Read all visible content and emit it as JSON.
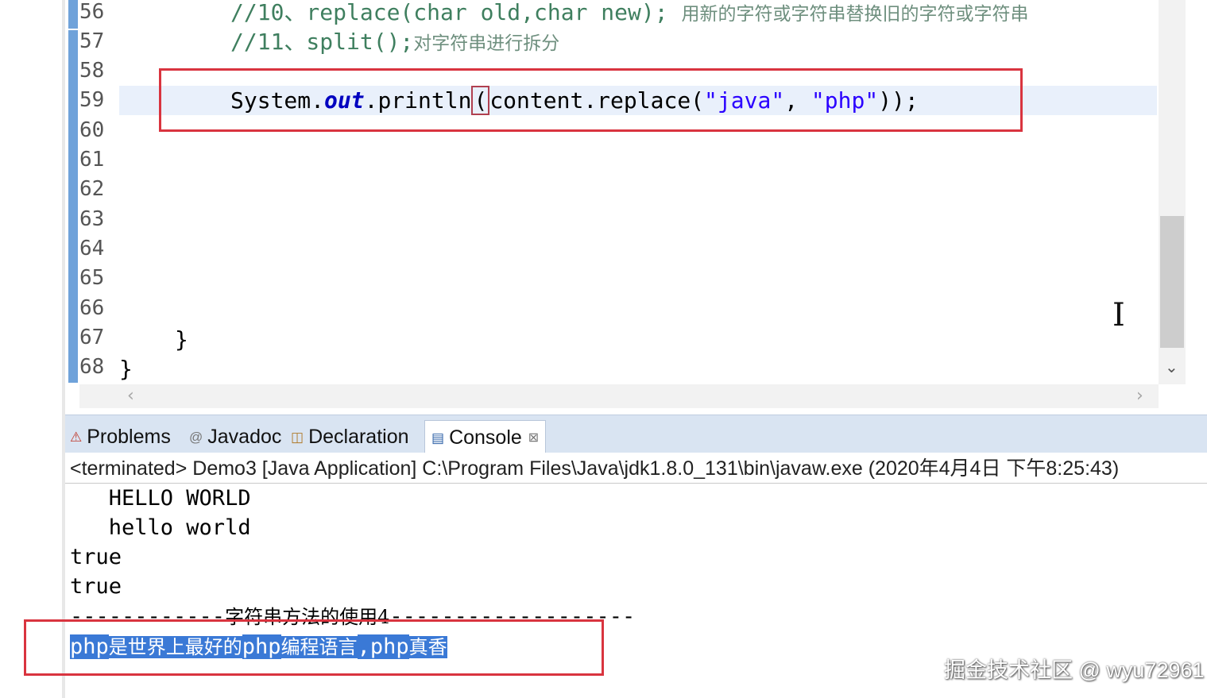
{
  "editor": {
    "line_numbers": [
      "56",
      "57",
      "58",
      "59",
      "60",
      "61",
      "62",
      "63",
      "64",
      "65",
      "66",
      "67",
      "68"
    ],
    "line56": {
      "code": "//10、replace(char old,char new);",
      "comment": "用新的字符或字符串替换旧的字符或字符串"
    },
    "line57": {
      "code": "//11、split();",
      "comment": "对字符串进行拆分"
    },
    "line59": {
      "prefix": "System.",
      "field": "out",
      "method": ".println",
      "open_paren": "(",
      "mid": "content.replace(",
      "str1": "\"java\"",
      "comma": ", ",
      "str2": "\"php\"",
      "suffix": "));"
    },
    "line67": "}",
    "line68": "}",
    "highlight_color": "#d9343f"
  },
  "tabs": {
    "problems": "Problems",
    "javadoc": "Javadoc",
    "declaration": "Declaration",
    "console": "Console"
  },
  "console": {
    "header": "<terminated> Demo3 [Java Application] C:\\Program Files\\Java\\jdk1.8.0_131\\bin\\javaw.exe (2020年4月4日 下午8:25:43)",
    "lines": [
      "   HELLO WORLD",
      "   hello world",
      "true",
      "true"
    ],
    "divider": {
      "left": "------------",
      "label": "字符串方法的使用4",
      "right": "-------------------"
    },
    "result": {
      "p1": "php",
      "t1": "是世界上最好的",
      "p2": "php",
      "t2": "编程语言",
      "p3": ",php",
      "t3": "真香"
    }
  },
  "watermark": "掘金技术社区 @ wyu72961"
}
